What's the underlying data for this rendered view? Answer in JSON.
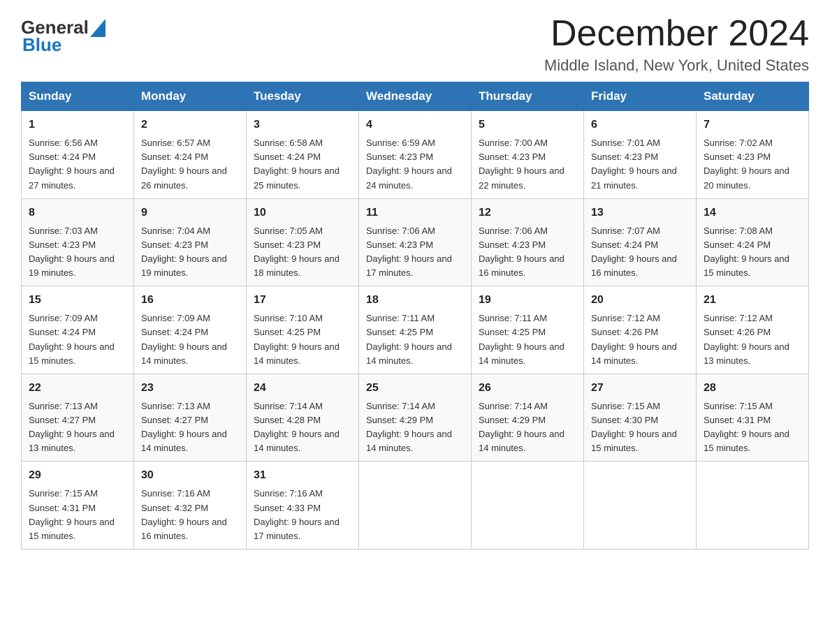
{
  "header": {
    "logo_general": "General",
    "logo_blue": "Blue",
    "month_title": "December 2024",
    "location": "Middle Island, New York, United States"
  },
  "weekdays": [
    "Sunday",
    "Monday",
    "Tuesday",
    "Wednesday",
    "Thursday",
    "Friday",
    "Saturday"
  ],
  "weeks": [
    [
      {
        "day": "1",
        "sunrise": "6:56 AM",
        "sunset": "4:24 PM",
        "daylight": "9 hours and 27 minutes."
      },
      {
        "day": "2",
        "sunrise": "6:57 AM",
        "sunset": "4:24 PM",
        "daylight": "9 hours and 26 minutes."
      },
      {
        "day": "3",
        "sunrise": "6:58 AM",
        "sunset": "4:24 PM",
        "daylight": "9 hours and 25 minutes."
      },
      {
        "day": "4",
        "sunrise": "6:59 AM",
        "sunset": "4:23 PM",
        "daylight": "9 hours and 24 minutes."
      },
      {
        "day": "5",
        "sunrise": "7:00 AM",
        "sunset": "4:23 PM",
        "daylight": "9 hours and 22 minutes."
      },
      {
        "day": "6",
        "sunrise": "7:01 AM",
        "sunset": "4:23 PM",
        "daylight": "9 hours and 21 minutes."
      },
      {
        "day": "7",
        "sunrise": "7:02 AM",
        "sunset": "4:23 PM",
        "daylight": "9 hours and 20 minutes."
      }
    ],
    [
      {
        "day": "8",
        "sunrise": "7:03 AM",
        "sunset": "4:23 PM",
        "daylight": "9 hours and 19 minutes."
      },
      {
        "day": "9",
        "sunrise": "7:04 AM",
        "sunset": "4:23 PM",
        "daylight": "9 hours and 19 minutes."
      },
      {
        "day": "10",
        "sunrise": "7:05 AM",
        "sunset": "4:23 PM",
        "daylight": "9 hours and 18 minutes."
      },
      {
        "day": "11",
        "sunrise": "7:06 AM",
        "sunset": "4:23 PM",
        "daylight": "9 hours and 17 minutes."
      },
      {
        "day": "12",
        "sunrise": "7:06 AM",
        "sunset": "4:23 PM",
        "daylight": "9 hours and 16 minutes."
      },
      {
        "day": "13",
        "sunrise": "7:07 AM",
        "sunset": "4:24 PM",
        "daylight": "9 hours and 16 minutes."
      },
      {
        "day": "14",
        "sunrise": "7:08 AM",
        "sunset": "4:24 PM",
        "daylight": "9 hours and 15 minutes."
      }
    ],
    [
      {
        "day": "15",
        "sunrise": "7:09 AM",
        "sunset": "4:24 PM",
        "daylight": "9 hours and 15 minutes."
      },
      {
        "day": "16",
        "sunrise": "7:09 AM",
        "sunset": "4:24 PM",
        "daylight": "9 hours and 14 minutes."
      },
      {
        "day": "17",
        "sunrise": "7:10 AM",
        "sunset": "4:25 PM",
        "daylight": "9 hours and 14 minutes."
      },
      {
        "day": "18",
        "sunrise": "7:11 AM",
        "sunset": "4:25 PM",
        "daylight": "9 hours and 14 minutes."
      },
      {
        "day": "19",
        "sunrise": "7:11 AM",
        "sunset": "4:25 PM",
        "daylight": "9 hours and 14 minutes."
      },
      {
        "day": "20",
        "sunrise": "7:12 AM",
        "sunset": "4:26 PM",
        "daylight": "9 hours and 14 minutes."
      },
      {
        "day": "21",
        "sunrise": "7:12 AM",
        "sunset": "4:26 PM",
        "daylight": "9 hours and 13 minutes."
      }
    ],
    [
      {
        "day": "22",
        "sunrise": "7:13 AM",
        "sunset": "4:27 PM",
        "daylight": "9 hours and 13 minutes."
      },
      {
        "day": "23",
        "sunrise": "7:13 AM",
        "sunset": "4:27 PM",
        "daylight": "9 hours and 14 minutes."
      },
      {
        "day": "24",
        "sunrise": "7:14 AM",
        "sunset": "4:28 PM",
        "daylight": "9 hours and 14 minutes."
      },
      {
        "day": "25",
        "sunrise": "7:14 AM",
        "sunset": "4:29 PM",
        "daylight": "9 hours and 14 minutes."
      },
      {
        "day": "26",
        "sunrise": "7:14 AM",
        "sunset": "4:29 PM",
        "daylight": "9 hours and 14 minutes."
      },
      {
        "day": "27",
        "sunrise": "7:15 AM",
        "sunset": "4:30 PM",
        "daylight": "9 hours and 15 minutes."
      },
      {
        "day": "28",
        "sunrise": "7:15 AM",
        "sunset": "4:31 PM",
        "daylight": "9 hours and 15 minutes."
      }
    ],
    [
      {
        "day": "29",
        "sunrise": "7:15 AM",
        "sunset": "4:31 PM",
        "daylight": "9 hours and 15 minutes."
      },
      {
        "day": "30",
        "sunrise": "7:16 AM",
        "sunset": "4:32 PM",
        "daylight": "9 hours and 16 minutes."
      },
      {
        "day": "31",
        "sunrise": "7:16 AM",
        "sunset": "4:33 PM",
        "daylight": "9 hours and 17 minutes."
      },
      null,
      null,
      null,
      null
    ]
  ]
}
